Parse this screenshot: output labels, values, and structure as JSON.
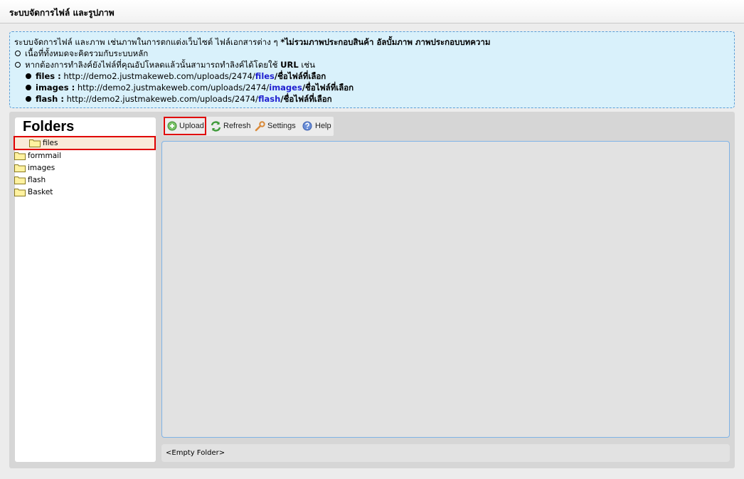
{
  "header": {
    "title": "ระบบจัดการไฟล์ และรูปภาพ"
  },
  "info": {
    "intro_text": "ระบบจัดการไฟล์ และภาพ เช่นภาพในการตกแต่งเว็บไซต์ ไฟล์เอกสารต่าง ๆ",
    "intro_note": "*ไม่รวมภาพประกอบสินค้า อัลบั้มภาพ ภาพประกอบบทความ",
    "bullet1": "เนื้อที่ทั้งหมดจะคิดรวมกับระบบหลัก",
    "bullet2_text": "หากต้องการทำลิงค์ยังไฟล์ที่คุณอัปโหลดแล้วนั้นสามารถทำลิงค์ได้โดยใช้",
    "bullet2_url": "URL",
    "bullet2_tail": "เช่น",
    "examples": [
      {
        "label": "files :",
        "base": "http://demo2.justmakeweb.com/uploads/2474/",
        "folder": "files",
        "tail": "/ชื่อไฟล์ที่เลือก"
      },
      {
        "label": "images :",
        "base": "http://demo2.justmakeweb.com/uploads/2474/",
        "folder": "images",
        "tail": "/ชื่อไฟล์ที่เลือก"
      },
      {
        "label": "flash :",
        "base": "http://demo2.justmakeweb.com/uploads/2474/",
        "folder": "flash",
        "tail": "/ชื่อไฟล์ที่เลือก"
      }
    ]
  },
  "folders": {
    "title": "Folders",
    "items": [
      {
        "label": "files",
        "selected": true
      },
      {
        "label": "formmail"
      },
      {
        "label": "images"
      },
      {
        "label": "flash"
      },
      {
        "label": "Basket"
      }
    ]
  },
  "toolbar": {
    "upload": "Upload",
    "refresh": "Refresh",
    "settings": "Settings",
    "help": "Help"
  },
  "status": {
    "text": "<Empty Folder>"
  },
  "colors": {
    "link_blue": "#1f1fd0",
    "highlight_red": "#e00000",
    "selected_bg": "#f9ebd9",
    "info_bg": "#d9f1fb"
  }
}
